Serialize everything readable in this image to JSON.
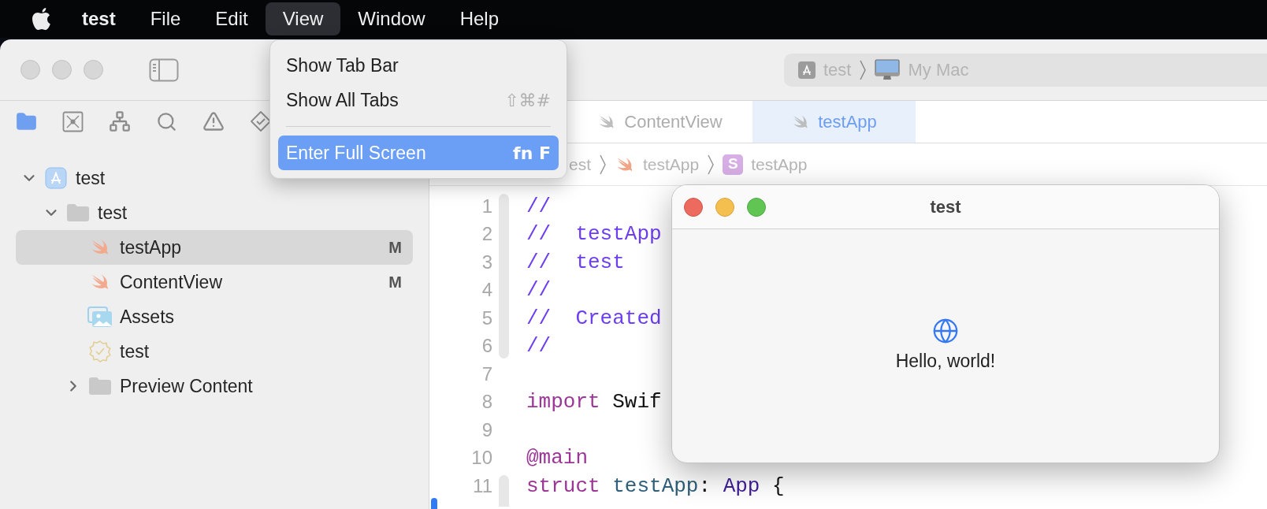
{
  "menu_bar": {
    "items": [
      {
        "label": "test",
        "kind": "app",
        "selected": false
      },
      {
        "label": "File",
        "kind": "menu",
        "selected": false
      },
      {
        "label": "Edit",
        "kind": "menu",
        "selected": false
      },
      {
        "label": "View",
        "kind": "menu",
        "selected": true
      },
      {
        "label": "Window",
        "kind": "menu",
        "selected": false
      },
      {
        "label": "Help",
        "kind": "menu",
        "selected": false
      }
    ]
  },
  "view_menu": {
    "items": [
      {
        "kind": "item",
        "label": "Show Tab Bar",
        "selected": false
      },
      {
        "kind": "item",
        "label": "Show All Tabs",
        "shortcut": "⇧⌘#",
        "selected": false
      },
      {
        "kind": "separator"
      },
      {
        "kind": "item",
        "label": "Enter Full Screen",
        "shortcut": "fn F",
        "selected": true
      }
    ]
  },
  "toolbar": {
    "scheme": {
      "target": "test",
      "destination": "My Mac"
    }
  },
  "navigator": {
    "tree": [
      {
        "name": "test",
        "kind": "project",
        "expanded": true,
        "selected": false,
        "children": [
          {
            "name": "test",
            "kind": "folder",
            "expanded": true,
            "selected": false,
            "children": [
              {
                "name": "testApp",
                "kind": "swift",
                "selected": true,
                "badge": "M"
              },
              {
                "name": "ContentView",
                "kind": "swift",
                "selected": false,
                "badge": "M"
              },
              {
                "name": "Assets",
                "kind": "assets",
                "selected": false
              },
              {
                "name": "test",
                "kind": "entitlements",
                "selected": false
              },
              {
                "name": "Preview Content",
                "kind": "folder",
                "expanded": false,
                "selected": false
              }
            ]
          }
        ]
      }
    ]
  },
  "editor": {
    "tabs": [
      {
        "label": "ContentView",
        "selected": false
      },
      {
        "label": "testApp",
        "selected": true
      }
    ],
    "jump_bar": [
      {
        "label": "est",
        "kind": "plain"
      },
      {
        "label": "testApp",
        "kind": "swift"
      },
      {
        "label": "testApp",
        "kind": "struct",
        "badge": "S"
      }
    ],
    "lines": [
      {
        "number": "1",
        "tokens": [
          {
            "kind": "comment",
            "text": "//"
          }
        ]
      },
      {
        "number": "2",
        "tokens": [
          {
            "kind": "comment",
            "text": "//  testApp"
          }
        ]
      },
      {
        "number": "3",
        "tokens": [
          {
            "kind": "comment",
            "text": "//  test"
          }
        ]
      },
      {
        "number": "4",
        "tokens": [
          {
            "kind": "comment",
            "text": "//"
          }
        ]
      },
      {
        "number": "5",
        "tokens": [
          {
            "kind": "comment",
            "text": "//  Created"
          }
        ]
      },
      {
        "number": "6",
        "tokens": [
          {
            "kind": "comment",
            "text": "//"
          }
        ]
      },
      {
        "number": "7"
      },
      {
        "number": "8",
        "tokens": [
          {
            "kind": "keyword",
            "text": "import"
          },
          {
            "kind": "plain",
            "text": " Swif"
          }
        ]
      },
      {
        "number": "9"
      },
      {
        "number": "10",
        "tokens": [
          {
            "kind": "keyword",
            "text": "@main"
          }
        ]
      },
      {
        "number": "11",
        "tokens": [
          {
            "kind": "keyword",
            "text": "struct"
          },
          {
            "kind": "type",
            "text": " testApp"
          },
          {
            "kind": "plain",
            "text": ":"
          },
          {
            "kind": "builtin",
            "text": " App"
          },
          {
            "kind": "plain",
            "text": " {"
          }
        ]
      }
    ]
  },
  "app_window": {
    "title": "test",
    "message": "Hello, world!"
  }
}
